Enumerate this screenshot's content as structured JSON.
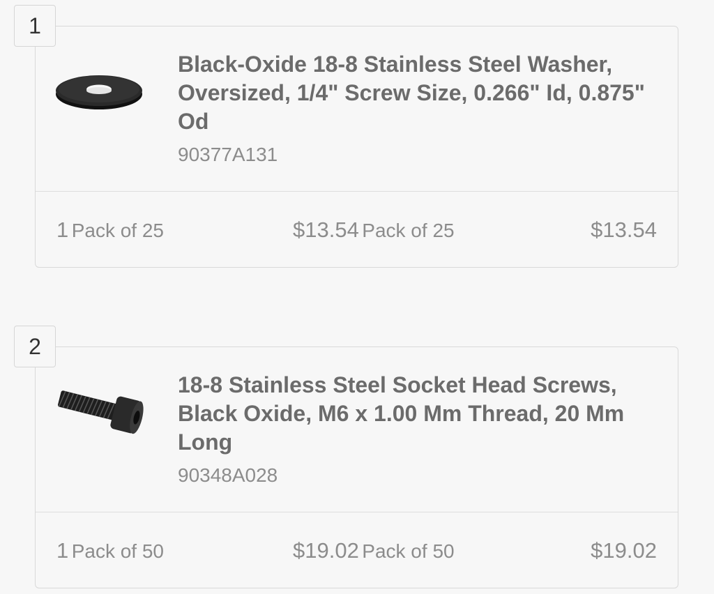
{
  "items": [
    {
      "index": "1",
      "title": "Black-Oxide 18-8 Stainless Steel Washer, Oversized, 1/4\" Screw Size, 0.266\" Id, 0.875\" Od",
      "part_number": "90377A131",
      "quantity": "1",
      "quantity_unit": "Pack of 25",
      "unit_price": "$13.54",
      "unit_price_unit": "Pack of 25",
      "total": "$13.54",
      "image_icon": "washer-icon"
    },
    {
      "index": "2",
      "title": "18-8 Stainless Steel Socket Head Screws, Black Oxide, M6 x 1.00 Mm Thread, 20 Mm Long",
      "part_number": "90348A028",
      "quantity": "1",
      "quantity_unit": "Pack of 50",
      "unit_price": "$19.02",
      "unit_price_unit": "Pack of 50",
      "total": "$19.02",
      "image_icon": "socket-head-screw-icon"
    }
  ],
  "colors": {
    "background": "#f7f7f7",
    "border": "#d9d9d9",
    "title_text": "#6b6b6b",
    "secondary_text": "#8c8c8c"
  }
}
